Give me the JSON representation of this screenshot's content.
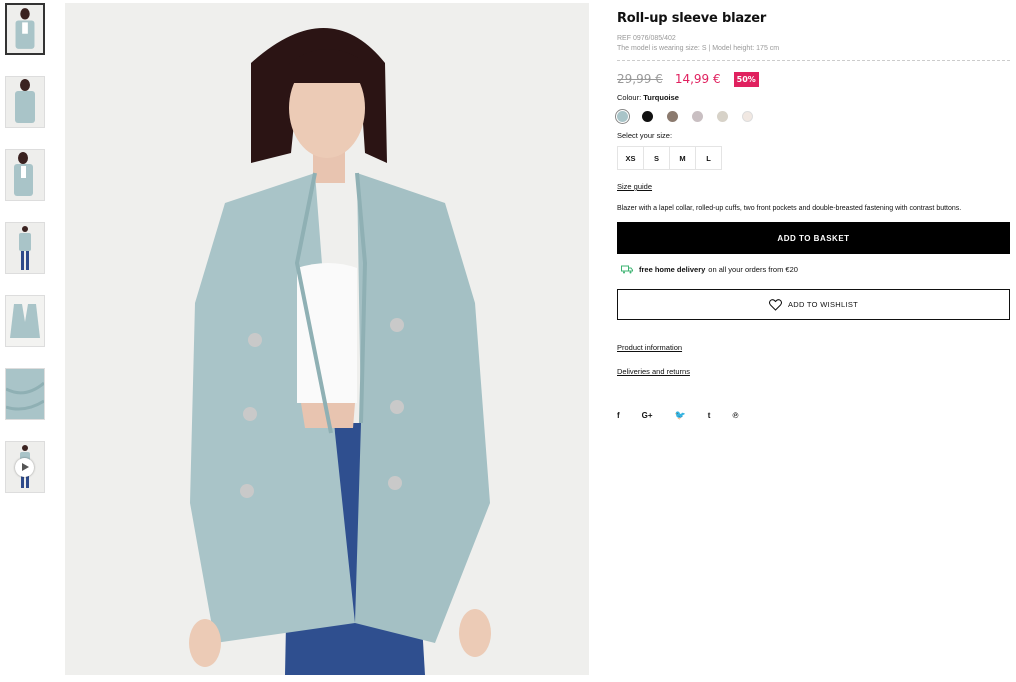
{
  "product": {
    "title": "Roll-up sleeve blazer",
    "ref": "REF 0976/085/402",
    "model_info": "The model is wearing size: S | Model height: 175 cm",
    "old_price": "29,99 €",
    "new_price": "14,99 €",
    "discount": "50%",
    "colour_label": "Colour:",
    "colour_value": "Turquoise",
    "size_label": "Select your size:",
    "sizes": [
      "XS",
      "S",
      "M",
      "L"
    ],
    "size_guide": "Size guide",
    "description": "Blazer with a lapel collar, rolled-up cuffs, two front pockets and double-breasted fastening with contrast buttons.",
    "add_to_basket": "ADD TO BASKET",
    "delivery_bold": "free home delivery",
    "delivery_rest": "on all your orders from €20",
    "add_to_wishlist": "ADD TO WISHLIST",
    "product_information": "Product information",
    "deliveries_returns": "Deliveries and returns"
  },
  "swatch_colors": [
    "#a9c4c8",
    "#111111",
    "#8b7a6e",
    "#c9bfc2",
    "#d7d2c8",
    "#f1e8e2"
  ],
  "social": [
    "f",
    "G+",
    "t-bird",
    "t",
    "p"
  ],
  "social_glyphs": [
    "f",
    "G+",
    "🐦",
    "t",
    "℗"
  ],
  "thumbnails": [
    "front-view",
    "back-view",
    "side-view",
    "full-length-view",
    "flat-lay",
    "fabric-detail",
    "video"
  ],
  "colors": {
    "accent": "#e0215f",
    "button": "#000000",
    "delivery_icon": "#3cb371"
  }
}
